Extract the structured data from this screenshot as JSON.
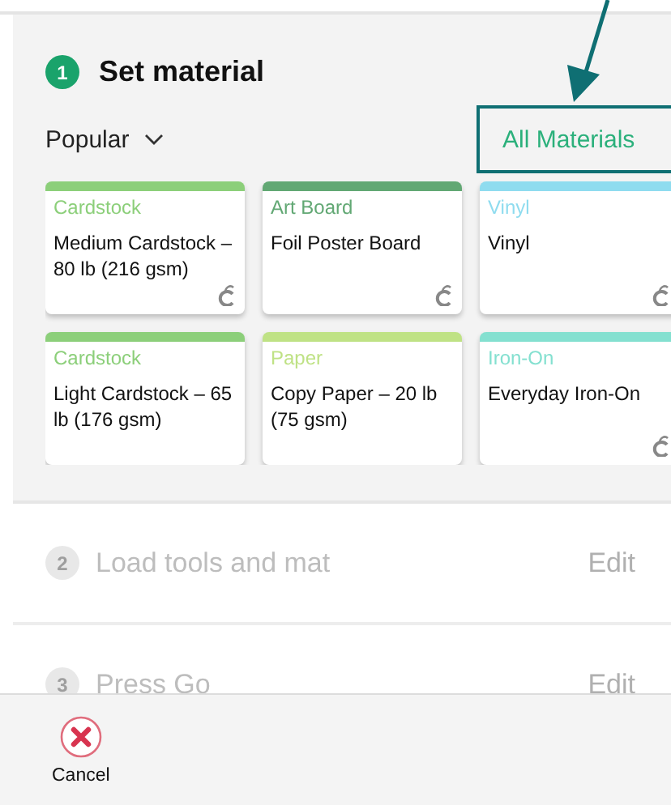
{
  "current_step": {
    "number": "1",
    "title": "Set material",
    "disabled": false
  },
  "filter": {
    "label": "Popular"
  },
  "all_materials_button": {
    "label": "All Materials"
  },
  "materials": [
    {
      "category": "Cardstock",
      "name": "Medium Cardstock – 80 lb (216 gsm)",
      "color": "#8ccf7a",
      "machine_icon": true
    },
    {
      "category": "Art Board",
      "name": "Foil Poster Board",
      "color": "#62a874",
      "machine_icon": true
    },
    {
      "category": "Vinyl",
      "name": "Vinyl",
      "color": "#8fdcef",
      "machine_icon": true
    },
    {
      "category": "Cardstock",
      "name": "Light Cardstock – 65 lb (176 gsm)",
      "color": "#8ccf7a",
      "machine_icon": false
    },
    {
      "category": "Paper",
      "name": "Copy Paper – 20 lb (75 gsm)",
      "color": "#bfe285",
      "machine_icon": false
    },
    {
      "category": "Iron-On",
      "name": "Everyday Iron-On",
      "color": "#84e0d0",
      "machine_icon": true
    }
  ],
  "steps": [
    {
      "number": "2",
      "title": "Load tools and mat",
      "action": "Edit",
      "disabled": true
    },
    {
      "number": "3",
      "title": "Press Go",
      "action": "Edit",
      "disabled": true
    }
  ],
  "footer": {
    "cancel": "Cancel"
  }
}
